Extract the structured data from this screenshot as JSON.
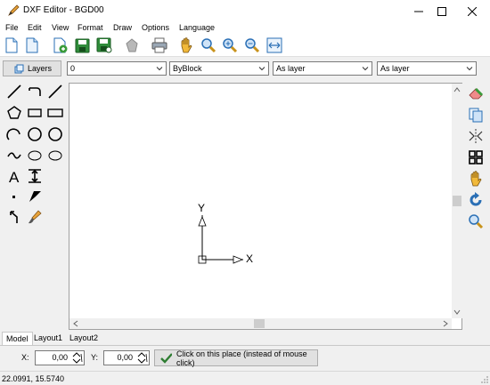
{
  "window": {
    "title": "DXF Editor - BGD00"
  },
  "menu": [
    "File",
    "Edit",
    "View",
    "Format",
    "Draw",
    "Options",
    "Language"
  ],
  "properties": {
    "layers_label": "Layers",
    "layer_value": "0",
    "color_value": "ByBlock",
    "linetype_value": "As layer",
    "lineweight_value": "As layer"
  },
  "canvas": {
    "axis_y": "Y",
    "axis_x": "X"
  },
  "tabs": [
    "Model",
    "Layout1",
    "Layout2"
  ],
  "coords": {
    "x_label": "X:",
    "x_value": "0,00",
    "y_label": "Y:",
    "y_value": "0,00",
    "click_button": "Click on this place (instead of mouse click)"
  },
  "status": {
    "cursor": "22.0991, 15.5740"
  },
  "colors": {
    "accent": "#2e7d32",
    "toolbar_bg": "#ffffff",
    "panel_bg": "#f0f0f0"
  }
}
